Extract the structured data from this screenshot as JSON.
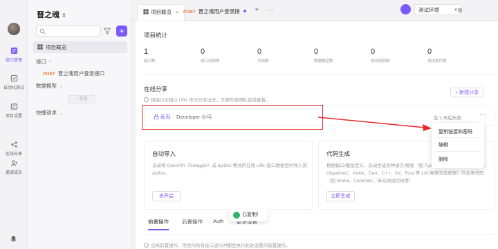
{
  "rail": {
    "items": [
      {
        "label": "接口管理",
        "icon": "api-icon",
        "active": true
      },
      {
        "label": "自动化测试",
        "icon": "test-icon",
        "active": false
      },
      {
        "label": "项目设置",
        "icon": "settings-icon",
        "active": false
      },
      {
        "label": "在线分享",
        "icon": "share-icon",
        "active": false
      },
      {
        "label": "邀请成员",
        "icon": "invite-icon",
        "active": false
      }
    ]
  },
  "sidebar": {
    "project_name": "晋之魂",
    "overview": "项目概览",
    "api_section": "接口",
    "api_item_method": "POST",
    "api_item_name": "晋之魂用户登录接口",
    "model_section": "数据模型",
    "new_label": "+ 新建",
    "shortcut_section": "快捷请求"
  },
  "topbar": {
    "tab_overview": "项目概览",
    "tab_api_method": "POST",
    "tab_api_name": "晋之魂用户登录接",
    "add_tab": "+",
    "more_tabs": "···",
    "env_name": "测试环境",
    "menu": "≡"
  },
  "stats": {
    "title": "项目统计",
    "items": [
      {
        "value": "1",
        "label": "接口数"
      },
      {
        "value": "0",
        "label": "接口用例数"
      },
      {
        "value": "0",
        "label": "文档数"
      },
      {
        "value": "0",
        "label": "数据模型数"
      },
      {
        "value": "0",
        "label": "测试用例数"
      },
      {
        "value": "0",
        "label": "测试套件数"
      }
    ]
  },
  "share": {
    "title": "在线分享",
    "hint": "将接口文档以 URL 形式分享出去，方便外部团队在线查看。",
    "new_button": "+ 新建分享",
    "row_privacy": "私有",
    "row_creator": "Deceloper 小马",
    "row_expire": "在 1 天后失效",
    "row_more": "···"
  },
  "import_card": {
    "title": "自动导入",
    "desc": "自动将 OpenAPI（Swagger）或 apiDoc 格式的在线 URL 接口数据定时导入到 Apifox。",
    "button": "去开启"
  },
  "codegen_card": {
    "title": "代码生成",
    "desc": "根据接口/模型定义，自动生成各种语言/框架（如 TypeScript、Java、Go、Swift、ObjectiveC、Kotlin、Dart、C++、C#、Rust 等 130 种语言及框架）的业务代码（如 Model、Controller、单元测试代码等）",
    "button": "立即生成"
  },
  "sub_tabs": [
    "前置操作",
    "后置操作",
    "Auth",
    "更多设置"
  ],
  "footer_hint": "全局前置操作，项目内所有接口运行时都会执行此处设置的前置操作。",
  "dropdown": {
    "items": [
      "复制链接和密码",
      "编辑",
      "删除"
    ]
  },
  "toast": {
    "text": "已复制！"
  },
  "colors": {
    "accent": "#7a5af8",
    "post": "#e8732e",
    "annotation_red": "#e52a2a",
    "success": "#2fb36e"
  }
}
